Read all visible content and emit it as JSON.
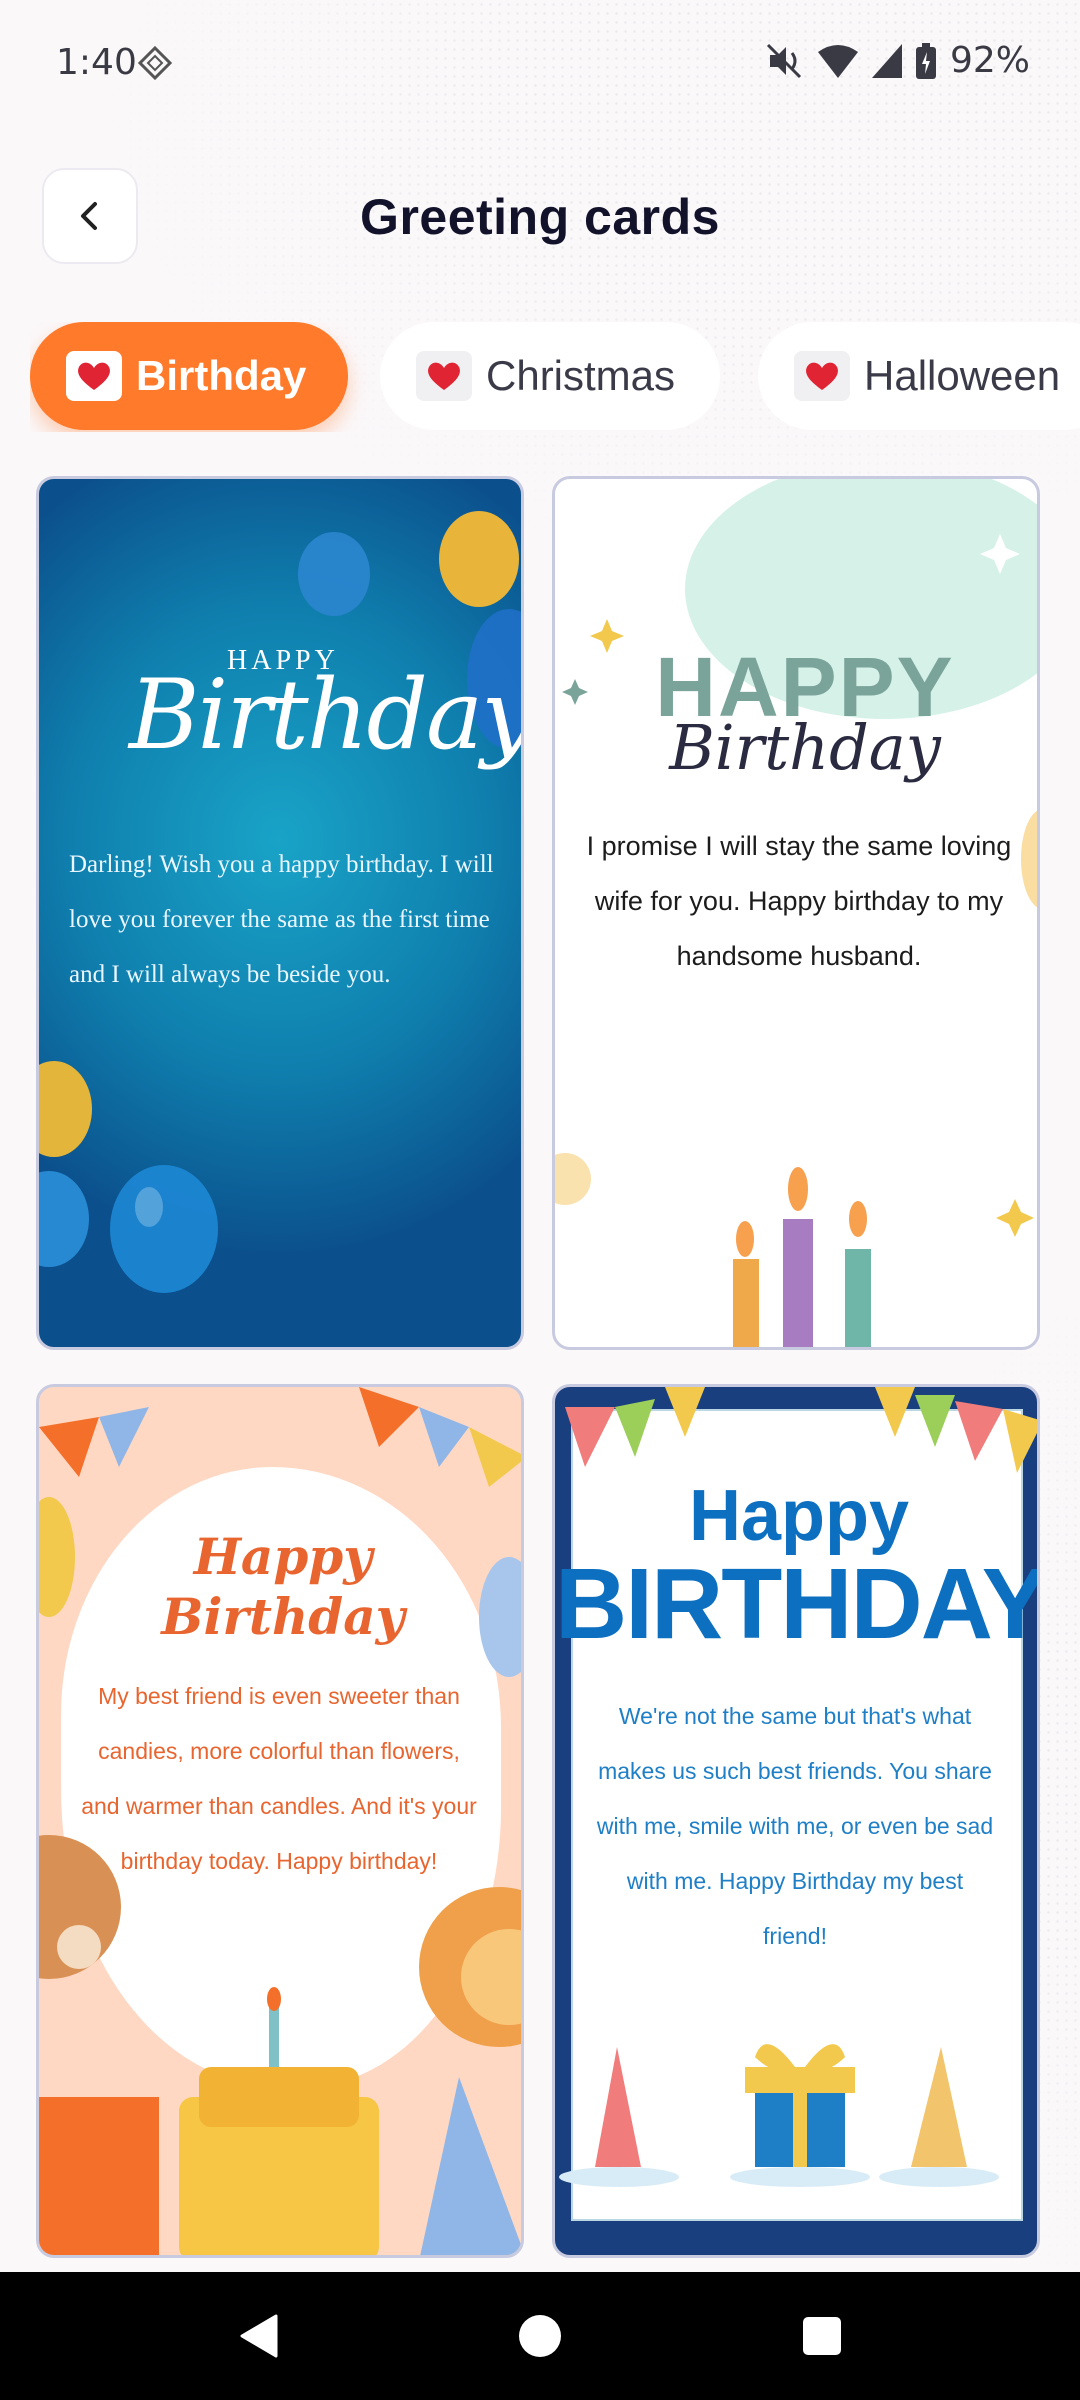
{
  "status_bar": {
    "time": "1:40",
    "battery": "92%"
  },
  "header": {
    "title": "Greeting cards"
  },
  "tabs": [
    {
      "label": "Birthday",
      "active": true
    },
    {
      "label": "Christmas",
      "active": false
    },
    {
      "label": "Halloween",
      "active": false
    }
  ],
  "cards": [
    {
      "heading_small": "HAPPY",
      "heading": "Birthday",
      "message": "Darling! Wish you a happy birthday. I will love you forever  the same as the first time and I will always be beside you."
    },
    {
      "heading_small": "HAPPY",
      "heading": "Birthday",
      "message": "I promise I will stay the same loving wife for you. Happy birthday to my handsome husband."
    },
    {
      "heading_small": "Happy",
      "heading": "Birthday",
      "message": "My best friend is even sweeter than candies, more colorful than flowers, and warmer than candles. And it's your birthday today. Happy birthday!"
    },
    {
      "heading_small": "Happy",
      "heading": "BIRTHDAY",
      "message": "We're not the same but that's what makes us such best friends. You share with me, smile with me, or even be sad with me. Happy Birthday my best friend!"
    }
  ],
  "colors": {
    "accent": "#ff7a2a",
    "title": "#12122a"
  },
  "icons": [
    "back-chevron-icon",
    "vpn-icon",
    "mute-icon",
    "wifi-icon",
    "signal-icon",
    "battery-icon",
    "heart-icon",
    "nav-back-icon",
    "nav-home-icon",
    "nav-recents-icon"
  ]
}
